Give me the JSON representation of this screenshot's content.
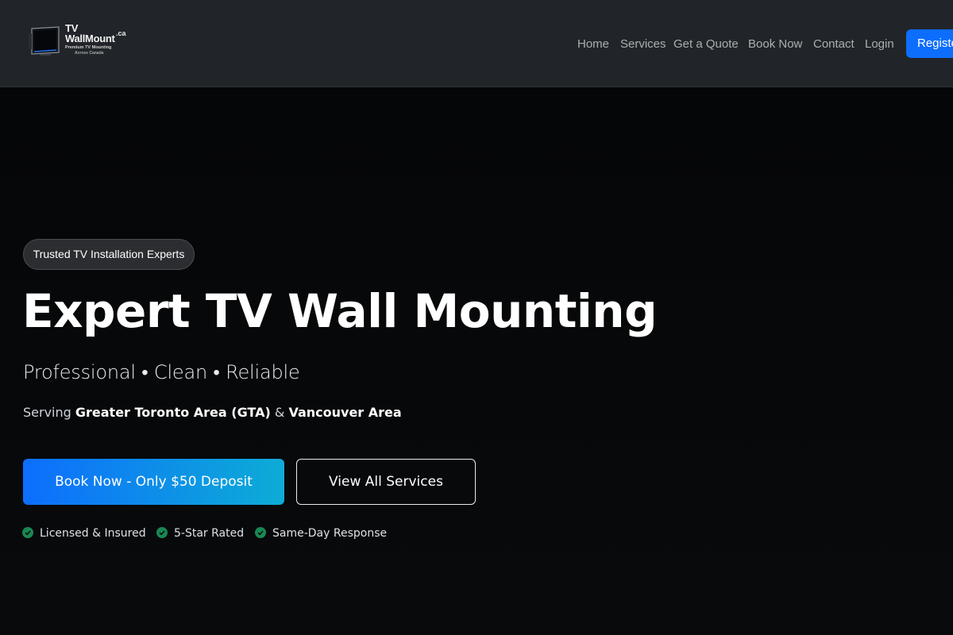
{
  "brand": {
    "line1": "TV",
    "line2": "WallMount",
    "tld": ".ca",
    "tagline1": "Premium TV Mounting",
    "tagline2": "Across Canada"
  },
  "nav": {
    "links": [
      "Home",
      "Services",
      "Get a Quote",
      "Book Now",
      "Contact",
      "Login"
    ],
    "register_label": "Register"
  },
  "hero": {
    "badge": "Trusted TV Installation Experts",
    "title": "Expert TV Wall Mounting",
    "subtitle": "Professional • Clean • Reliable",
    "area_prefix": "Serving ",
    "area_1": "Greater Toronto Area (GTA)",
    "area_joiner": " & ",
    "area_2": "Vancouver Area",
    "primary_cta": "Book Now - Only $50 Deposit",
    "secondary_cta": "View All Services",
    "features": [
      "Licensed & Insured",
      "5-Star Rated",
      "Same-Day Response"
    ]
  },
  "colors": {
    "navbar_bg": "#212529",
    "hero_bg": "#070809",
    "primary": "#0d6efd",
    "primary_gradient_end": "#0dacd6",
    "check_green": "#198754"
  },
  "icons": {
    "logo": "tv-icon",
    "feature_check": "check-circle-icon"
  }
}
